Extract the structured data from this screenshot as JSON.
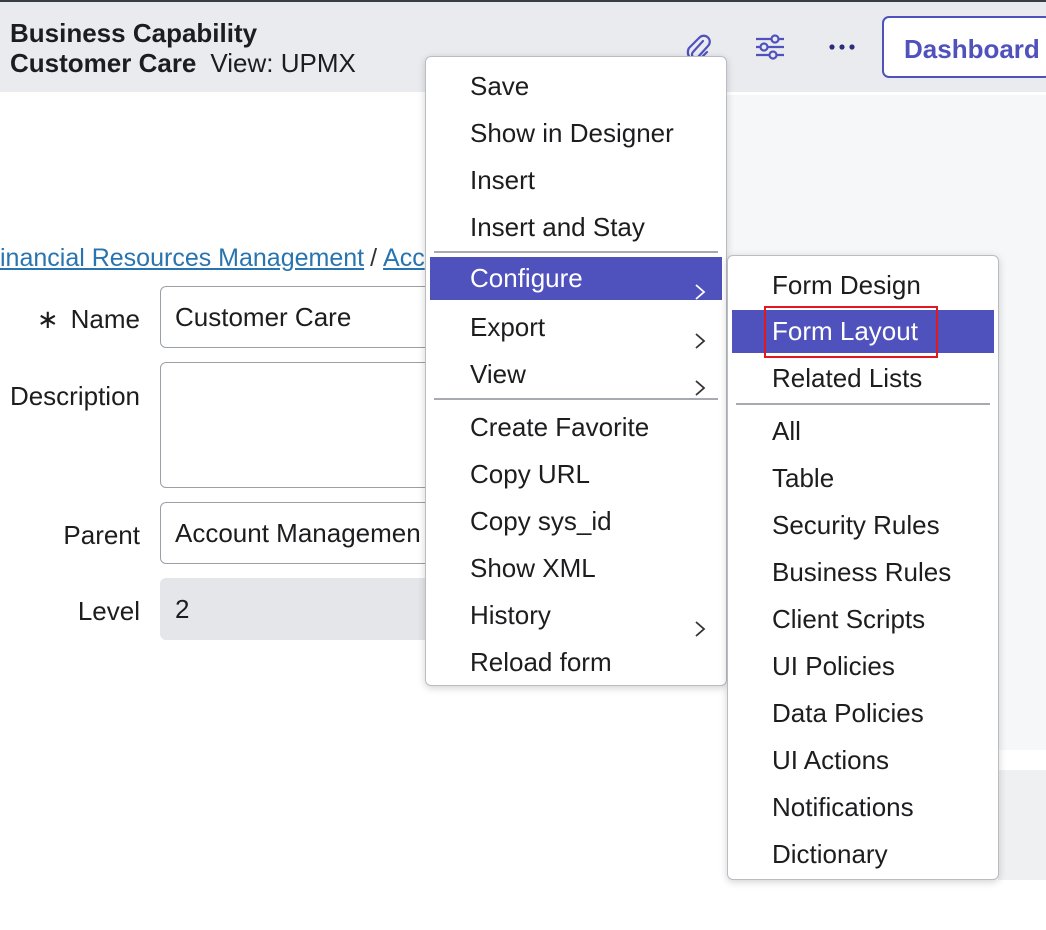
{
  "header": {
    "line1": "Business Capability",
    "record_name": "Customer Care",
    "view_label": "View: UPMX",
    "attachment_icon": "paperclip-icon",
    "settings_icon": "sliders-icon",
    "more_icon": "more-horizontal-icon",
    "dashboard_label": "Dashboard"
  },
  "breadcrumb": {
    "link1": "inancial Resources Management",
    "separator": "/",
    "link2": "Acc"
  },
  "form": {
    "name_label": "Name",
    "name_required_mark": "∗",
    "name_value": "Customer Care",
    "description_label": "Description",
    "description_value": "",
    "parent_label": "Parent",
    "parent_value": "Account Managemen",
    "level_label": "Level",
    "level_value": "2"
  },
  "context_menu": {
    "items": [
      {
        "label": "Save"
      },
      {
        "label": "Show in Designer"
      },
      {
        "label": "Insert"
      },
      {
        "label": "Insert and Stay"
      },
      {
        "label": "Configure",
        "submenu": true,
        "active": true
      },
      {
        "label": "Export",
        "submenu": true
      },
      {
        "label": "View",
        "submenu": true
      },
      {
        "label": "Create Favorite"
      },
      {
        "label": "Copy URL"
      },
      {
        "label": "Copy sys_id"
      },
      {
        "label": "Show XML"
      },
      {
        "label": "History",
        "submenu": true
      },
      {
        "label": "Reload form"
      }
    ]
  },
  "configure_submenu": {
    "items": [
      {
        "label": "Form Design"
      },
      {
        "label": "Form Layout",
        "active": true,
        "highlighted": true
      },
      {
        "label": "Related Lists"
      },
      {
        "label": "All"
      },
      {
        "label": "Table"
      },
      {
        "label": "Security Rules"
      },
      {
        "label": "Business Rules"
      },
      {
        "label": "Client Scripts"
      },
      {
        "label": "UI Policies"
      },
      {
        "label": "Data Policies"
      },
      {
        "label": "UI Actions"
      },
      {
        "label": "Notifications"
      },
      {
        "label": "Dictionary"
      }
    ]
  },
  "colors": {
    "accent": "#4f52bd",
    "link": "#2874b0",
    "highlight_box": "#e0191e",
    "header_bg": "#e9ebef"
  }
}
